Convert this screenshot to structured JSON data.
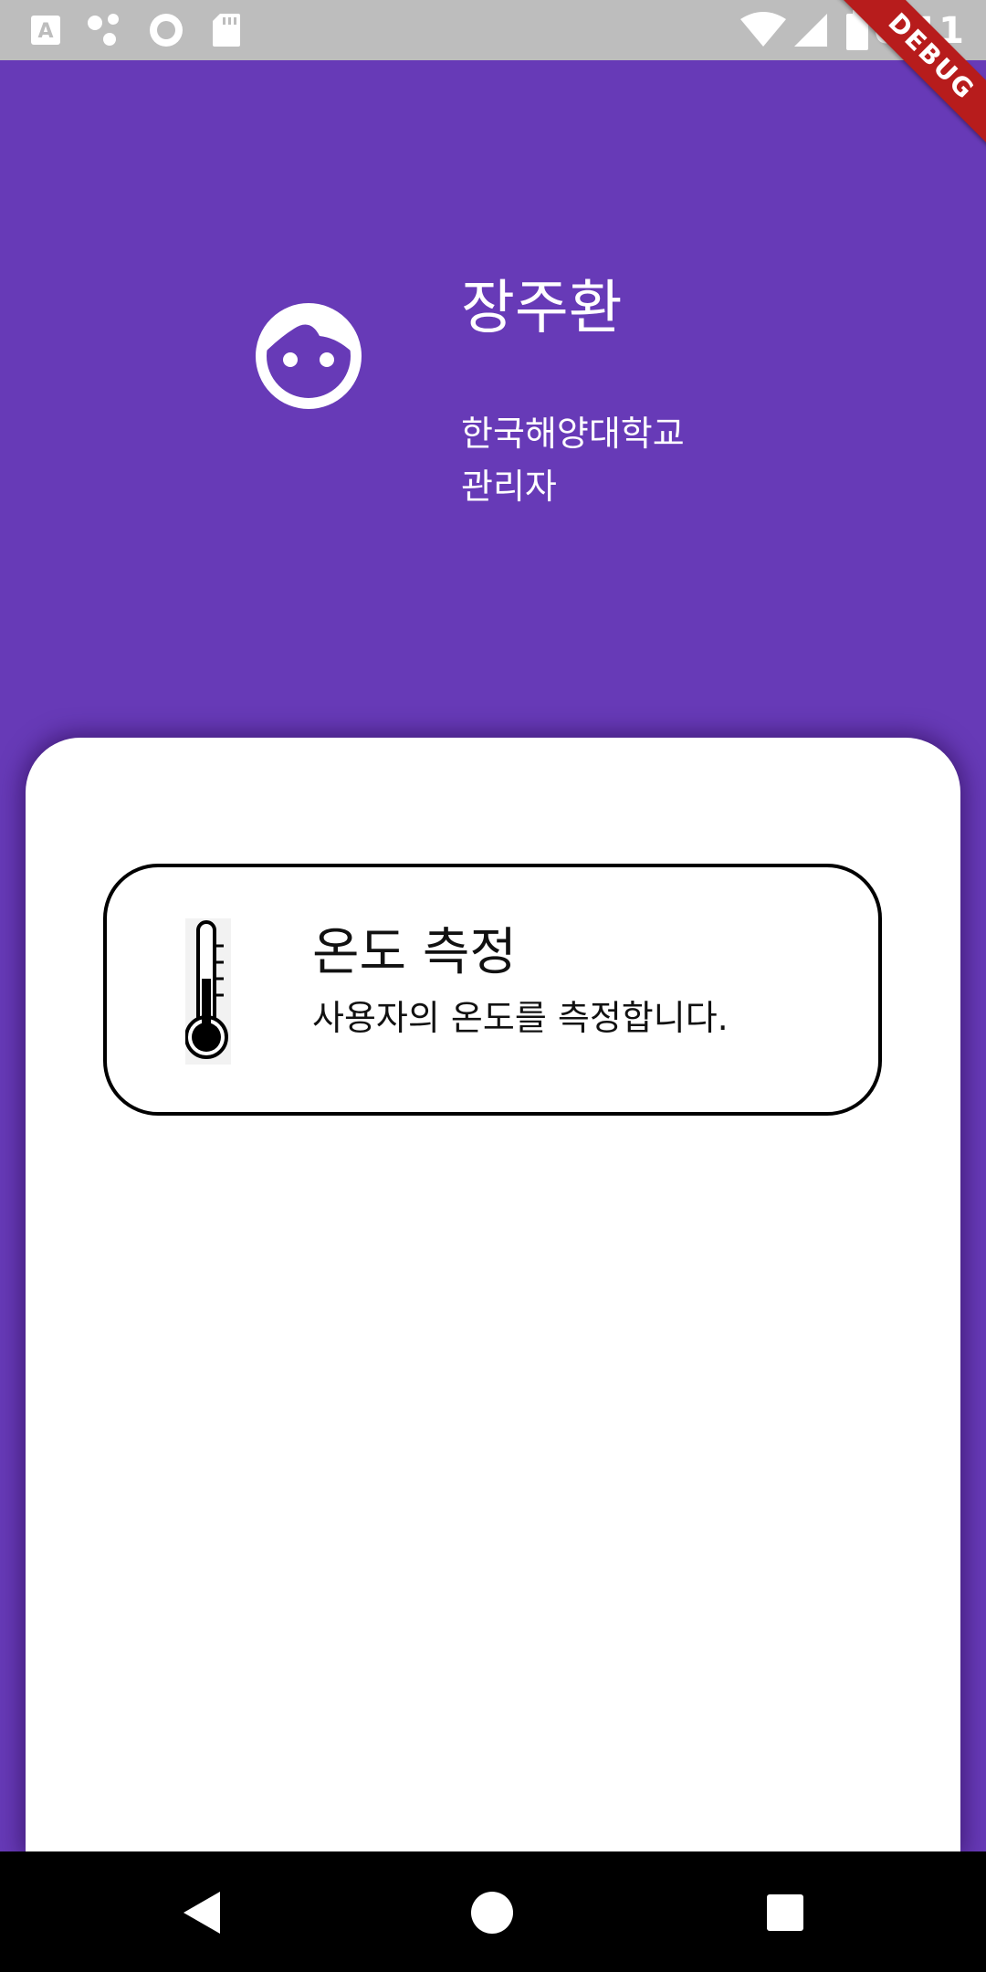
{
  "status_bar": {
    "time": "6:11",
    "icons": [
      "a-notification-icon",
      "dots-icon",
      "circle-icon",
      "sd-card-icon",
      "wifi-icon",
      "signal-icon",
      "battery-icon"
    ]
  },
  "debug_banner": "DEBUG",
  "profile": {
    "avatar_icon": "face-icon",
    "name": "장주환",
    "organization": "한국해양대학교",
    "role": "관리자"
  },
  "menu": {
    "items": [
      {
        "icon": "thermometer-icon",
        "title": "온도 측정",
        "description": "사용자의 온도를 측정합니다."
      }
    ]
  },
  "nav_bar": {
    "buttons": [
      "back-icon",
      "home-icon",
      "recents-icon"
    ]
  },
  "colors": {
    "primary": "#673AB7",
    "status_bar": "#BDBDBD",
    "card_border": "#000000",
    "debug_ribbon": "#B71C1C"
  }
}
